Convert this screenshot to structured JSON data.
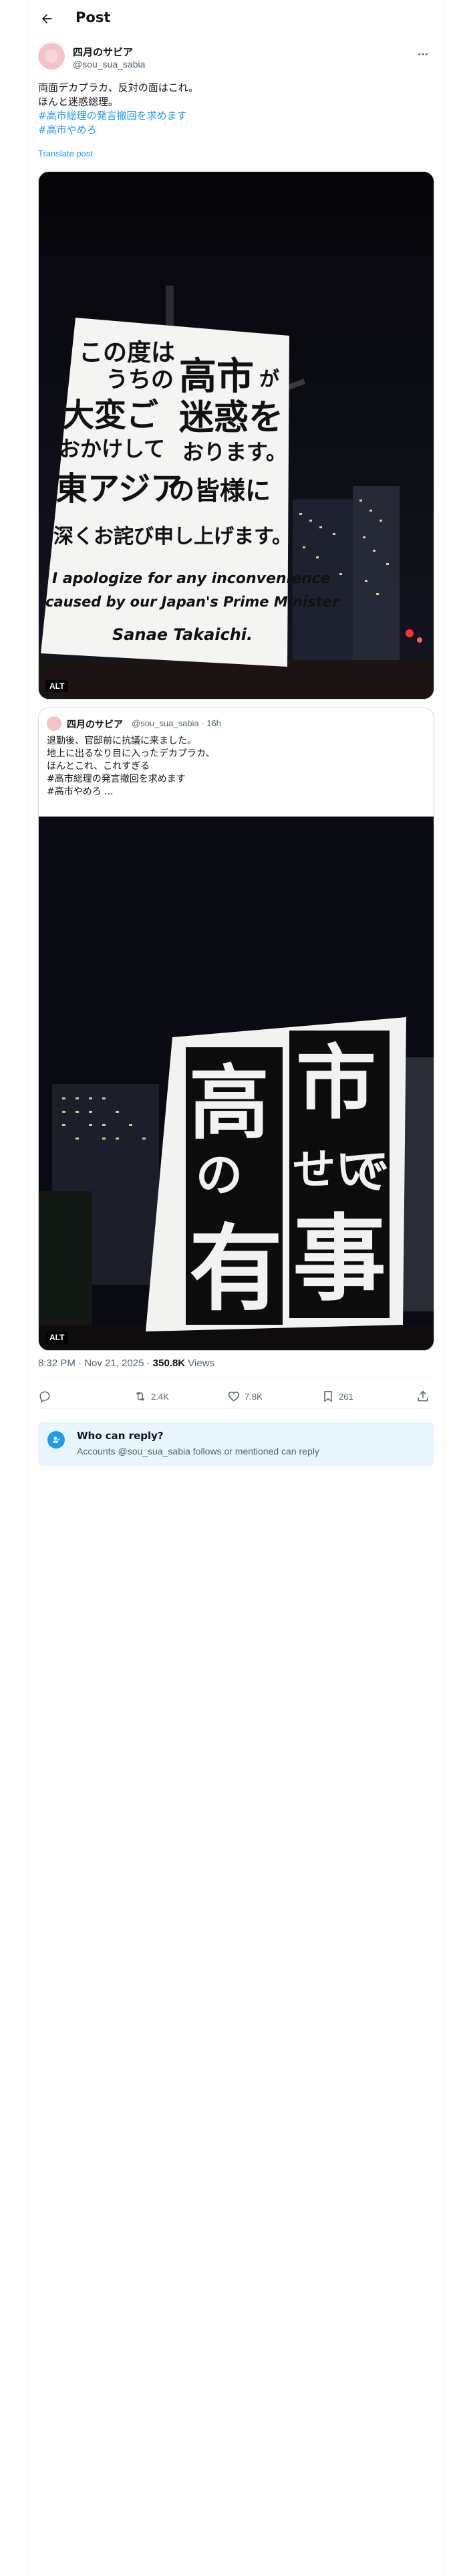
{
  "header": {
    "title": "Post"
  },
  "post": {
    "author_name": "四月のサビア",
    "author_handle": "@sou_sua_sabia",
    "text_lines": [
      "両面デカプラカ、反対の面はこれ。",
      "ほんと迷惑総理。"
    ],
    "hashtags": [
      "#高市総理の発言撤回を求めます",
      "#高市やめろ"
    ],
    "translate": "Translate post",
    "media_alt": "ALT",
    "sign1": {
      "jp_lines": [
        "この度は",
        "うちの",
        "高市",
        "が",
        "大変ご",
        "迷惑を",
        "おかけして",
        "おります。",
        "東アジア",
        "の皆様に",
        "深くお詫び申し上げます。"
      ],
      "en_lines": [
        "I apologize for any inconvenience",
        "caused by our Japan's Prime Minister",
        "Sanae Takaichi."
      ]
    }
  },
  "quote": {
    "author_name": "四月のサビア",
    "author_handle": "@sou_sua_sabia · 16h",
    "text_lines": [
      "退勤後、官邸前に抗議に来ました。",
      "地上に出るなり目に入ったデカプラカ、",
      "ほんとこれ、これすぎる",
      "#高市総理の発言撤回を求めます",
      "#高市やめろ ..."
    ],
    "media_alt": "ALT",
    "sign2": {
      "chars": [
        "高",
        "市",
        "の",
        "せい",
        "で",
        "有",
        "事"
      ]
    }
  },
  "meta": {
    "time": "8:32 PM · Nov 21, 2025 · ",
    "views_count": "350.8K",
    "views_label": " Views"
  },
  "actions": {
    "reposts": "2.4K",
    "likes": "7.8K",
    "bookmarks": "261"
  },
  "reply_info": {
    "title": "Who can reply?",
    "subtitle": "Accounts @sou_sua_sabia follows or mentioned can reply"
  },
  "colors": {
    "accent": "#1d9bf0",
    "reply_bg": "#e8f5fd"
  }
}
